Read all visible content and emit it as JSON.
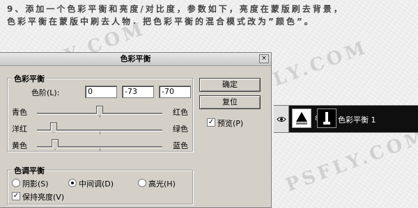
{
  "instructions": {
    "line1": "9、添加一个色彩平衡和亮度/对比度，参数如下，亮度在蒙版刷去背景，",
    "line2": "色彩平衡在蒙版中刷去人物，把色彩平衡的混合模式改为”颜色”。"
  },
  "watermark": {
    "text1": "PSFLY.COM",
    "text2": "WWW.PSFLY.COM",
    "text3": "PSFLY.COM"
  },
  "dialog": {
    "title": "色彩平衡",
    "close_glyph": "×",
    "color_balance": {
      "group_title": "色彩平衡",
      "levels_label": "色阶(L):",
      "levels": [
        "0",
        "-73",
        "-70"
      ],
      "sliders": [
        {
          "left": "青色",
          "right": "红色",
          "value": 0
        },
        {
          "left": "洋红",
          "right": "绿色",
          "value": -73
        },
        {
          "left": "黄色",
          "right": "蓝色",
          "value": -70
        }
      ]
    },
    "tone_balance": {
      "group_title": "色调平衡",
      "shadows_label": "阴影(S)",
      "midtones_label": "中间调(D)",
      "highlights_label": "高光(H)",
      "selected": "midtones",
      "preserve_luminosity_label": "保持亮度(V)",
      "preserve_luminosity_checked": true
    },
    "ok_label": "确定",
    "reset_label": "复位",
    "preview_label": "预览(P)",
    "preview_checked": true,
    "check_glyph": "✓"
  },
  "layers": {
    "visibility_icon": "eye-icon",
    "link_glyph": "8",
    "name": "色彩平衡 1"
  }
}
